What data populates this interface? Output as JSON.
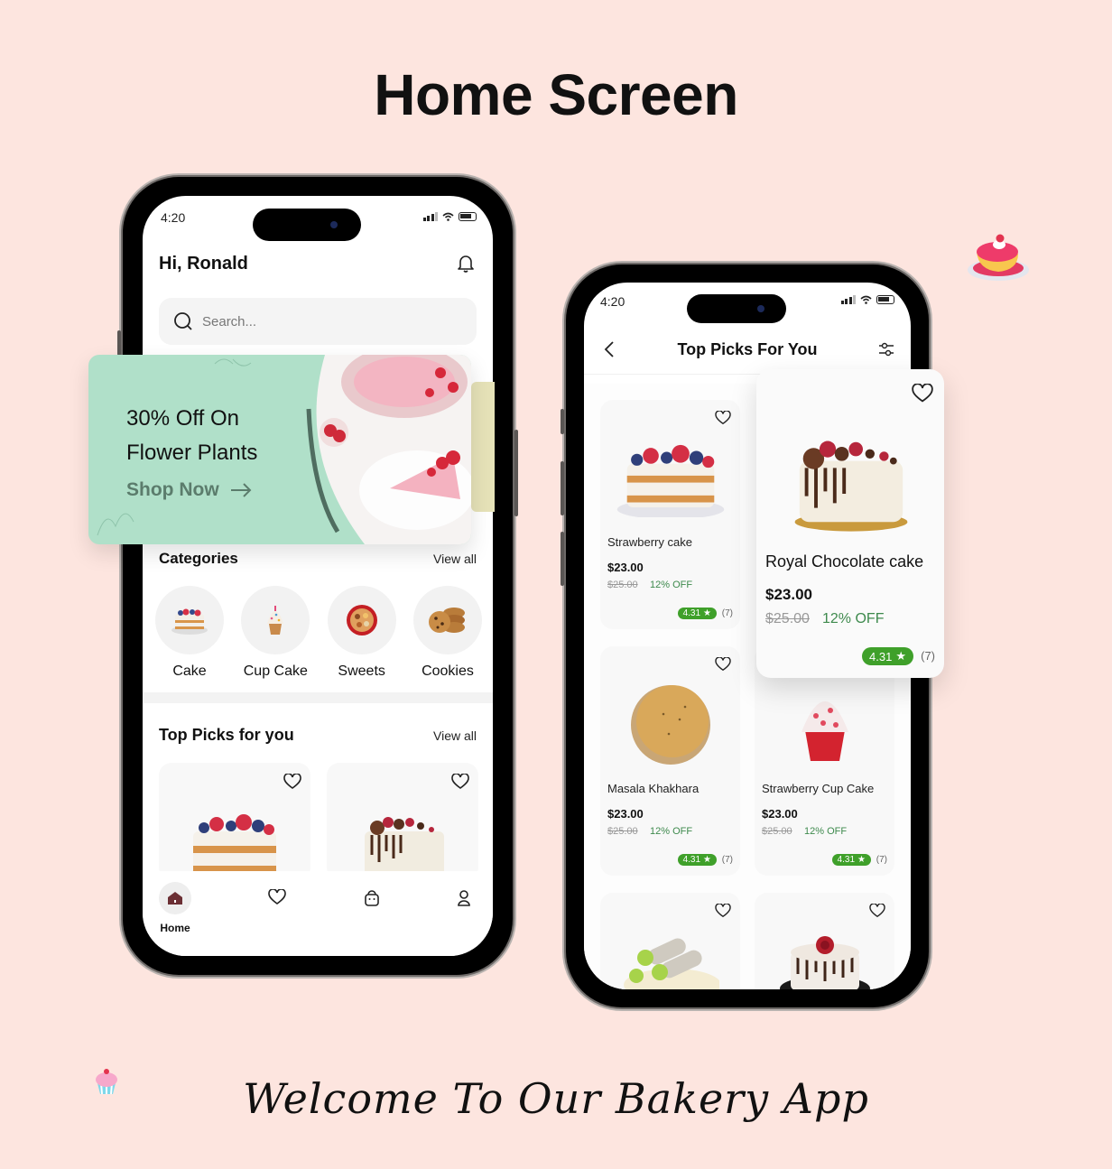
{
  "page": {
    "title": "Home Screen",
    "footer": "Welcome To Our Bakery App"
  },
  "decorations": {
    "top_right": "cake-illustration",
    "bottom_left": "cupcake-illustration"
  },
  "colors": {
    "background": "#fde5df",
    "banner_green": "#b0e0c9",
    "rating_green": "#3fa02a",
    "discount_green": "#3e8a4d",
    "home_icon": "#6b2f34"
  },
  "home_screen": {
    "status": {
      "time": "4:20"
    },
    "greeting": "Hi, Ronald",
    "search": {
      "placeholder": "Search..."
    },
    "banner": {
      "line1": "30% Off On",
      "line2": "Flower Plants",
      "cta": "Shop Now"
    },
    "categories": {
      "title": "Categories",
      "view_all": "View all",
      "items": [
        {
          "label": "Cake",
          "icon": "cake"
        },
        {
          "label": "Cup Cake",
          "icon": "cupcake"
        },
        {
          "label": "Sweets",
          "icon": "sweets"
        },
        {
          "label": "Cookies",
          "icon": "cookies"
        }
      ]
    },
    "top_picks": {
      "title": "Top Picks for you",
      "view_all": "View all",
      "items": [
        {
          "image": "strawberry-cake"
        },
        {
          "image": "chocolate-drip-cake"
        }
      ]
    },
    "bottom_nav": {
      "items": [
        {
          "label": "Home",
          "icon": "home",
          "active": true
        },
        {
          "label": "",
          "icon": "heart",
          "active": false
        },
        {
          "label": "",
          "icon": "bag",
          "active": false
        },
        {
          "label": "",
          "icon": "profile",
          "active": false
        }
      ]
    }
  },
  "top_picks_screen": {
    "status": {
      "time": "4:20"
    },
    "title": "Top Picks For You",
    "products": [
      {
        "name": "Strawberry cake",
        "price": "$23.00",
        "old_price": "$25.00",
        "discount": "12% OFF",
        "rating": "4.31",
        "reviews": "(7)"
      },
      {
        "name": "Royal Chocolate cake",
        "price": "$23.00",
        "old_price": "$25.00",
        "discount": "12% OFF",
        "rating": "4.31",
        "reviews": "(7)",
        "highlighted": true
      },
      {
        "name": "Masala Khakhara",
        "price": "$23.00",
        "old_price": "$25.00",
        "discount": "12% OFF",
        "rating": "4.31",
        "reviews": "(7)"
      },
      {
        "name": "Strawberry Cup Cake",
        "price": "$23.00",
        "old_price": "$25.00",
        "discount": "12% OFF",
        "rating": "4.31",
        "reviews": "(7)"
      },
      {
        "name": "",
        "image": "kaju-roll"
      },
      {
        "name": "",
        "image": "rose-chocolate-cake"
      }
    ]
  }
}
